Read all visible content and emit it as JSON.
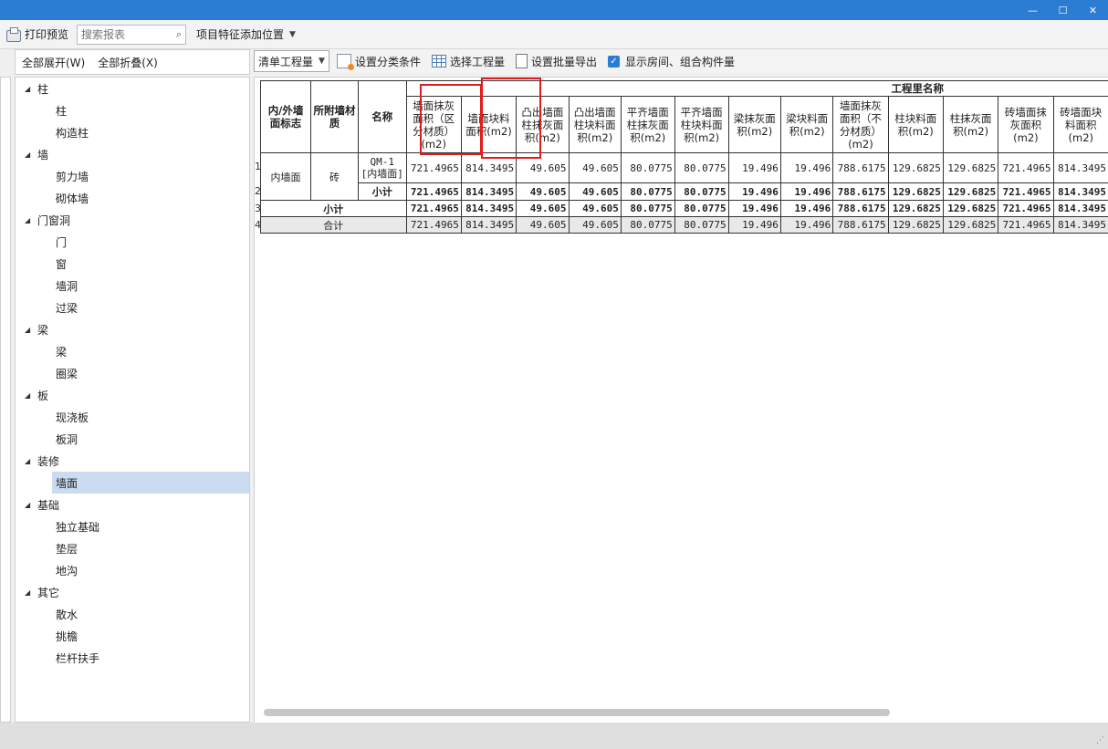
{
  "window": {
    "minimize": "—",
    "restore": "☐",
    "close": "✕"
  },
  "toolbar": {
    "print_preview": "打印预览",
    "search_placeholder": "搜索报表",
    "add_feature_position": "项目特征添加位置"
  },
  "left_panel": {
    "expand_all": "全部展开(W)",
    "collapse_all": "全部折叠(X)",
    "tree": [
      {
        "label": "柱",
        "children": [
          "柱",
          "构造柱"
        ]
      },
      {
        "label": "墙",
        "children": [
          "剪力墙",
          "砌体墙"
        ]
      },
      {
        "label": "门窗洞",
        "children": [
          "门",
          "窗",
          "墙洞",
          "过梁"
        ]
      },
      {
        "label": "梁",
        "children": [
          "梁",
          "圈梁"
        ]
      },
      {
        "label": "板",
        "children": [
          "现浇板",
          "板洞"
        ]
      },
      {
        "label": "装修",
        "children": [
          "墙面"
        ]
      },
      {
        "label": "基础",
        "children": [
          "独立基础",
          "垫层",
          "地沟"
        ]
      },
      {
        "label": "其它",
        "children": [
          "散水",
          "挑檐",
          "栏杆扶手"
        ]
      }
    ],
    "selected": "墙面"
  },
  "report_toolbar": {
    "quantity_combo": "清单工程量",
    "set_filter": "设置分类条件",
    "select_quantity": "选择工程量",
    "set_batch_export": "设置批量导出",
    "show_rooms": "显示房间、组合构件量"
  },
  "report": {
    "group_header": "工程里名称",
    "fixed_headers": [
      "内/外墙面标志",
      "所附墙材质",
      "名称"
    ],
    "columns": [
      "墙面抹灰面积（区分材质）(m2)",
      "墙面块料面积(m2)",
      "凸出墙面柱抹灰面积(m2)",
      "凸出墙面柱块料面积(m2)",
      "平齐墙面柱抹灰面积(m2)",
      "平齐墙面柱块料面积(m2)",
      "梁抹灰面积(m2)",
      "梁块料面积(m2)",
      "墙面抹灰面积（不分材质）(m2)",
      "柱块料面积(m2)",
      "柱抹灰面积(m2)",
      "砖墙面抹灰面积(m2)",
      "砖墙面块料面积(m2)"
    ],
    "row_numbers": [
      "1",
      "2",
      "3",
      "4"
    ],
    "wall_flag": "内墙面",
    "material": "砖",
    "item_name": "QM-1 [内墙面]",
    "subtotal_label": "小计",
    "subtotal_label2": "小计",
    "total_label": "合计",
    "rows": [
      [
        "721.4965",
        "814.3495",
        "49.605",
        "49.605",
        "80.0775",
        "80.0775",
        "19.496",
        "19.496",
        "788.6175",
        "129.6825",
        "129.6825",
        "721.4965",
        "814.3495"
      ],
      [
        "721.4965",
        "814.3495",
        "49.605",
        "49.605",
        "80.0775",
        "80.0775",
        "19.496",
        "19.496",
        "788.6175",
        "129.6825",
        "129.6825",
        "721.4965",
        "814.3495"
      ],
      [
        "721.4965",
        "814.3495",
        "49.605",
        "49.605",
        "80.0775",
        "80.0775",
        "19.496",
        "19.496",
        "788.6175",
        "129.6825",
        "129.6825",
        "721.4965",
        "814.3495"
      ],
      [
        "721.4965",
        "814.3495",
        "49.605",
        "49.605",
        "80.0775",
        "80.0775",
        "19.496",
        "19.496",
        "788.6175",
        "129.6825",
        "129.6825",
        "721.4965",
        "814.3495"
      ]
    ]
  }
}
